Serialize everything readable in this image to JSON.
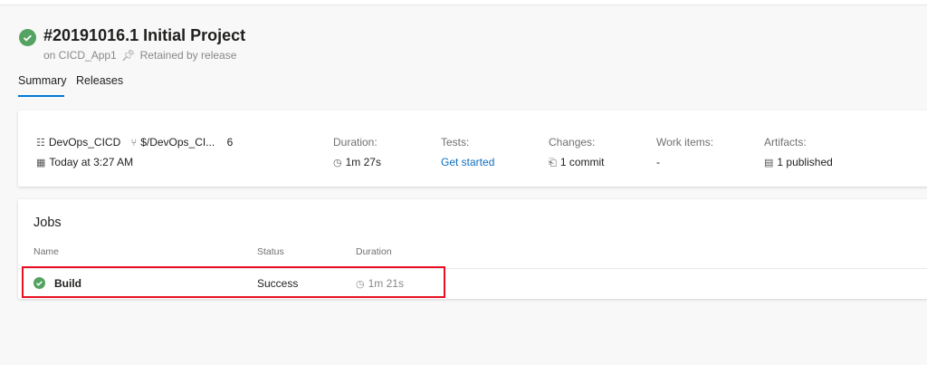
{
  "header": {
    "title": "#20191016.1 Initial Project",
    "repo": "on CICD_App1",
    "retention": "Retained by release"
  },
  "tabs": [
    {
      "label": "Summary",
      "active": true
    },
    {
      "label": "Releases",
      "active": false
    }
  ],
  "summary": {
    "project": "DevOps_CICD",
    "branch": "$/DevOps_CI...",
    "changeset": "6",
    "date": "Today at 3:27 AM",
    "duration": {
      "label": "Duration:",
      "value": "1m 27s"
    },
    "tests": {
      "label": "Tests:",
      "value": "Get started"
    },
    "changes": {
      "label": "Changes:",
      "value": "1 commit"
    },
    "work_items": {
      "label": "Work items:",
      "value": "-"
    },
    "artifacts": {
      "label": "Artifacts:",
      "value": "1 published"
    }
  },
  "jobs": {
    "title": "Jobs",
    "columns": [
      "Name",
      "Status",
      "Duration"
    ],
    "rows": [
      {
        "name": "Build",
        "status": "Success",
        "duration": "1m 21s"
      }
    ]
  },
  "colors": {
    "success": "#55a362",
    "accent": "#0078d4",
    "highlight": "#e81123"
  }
}
